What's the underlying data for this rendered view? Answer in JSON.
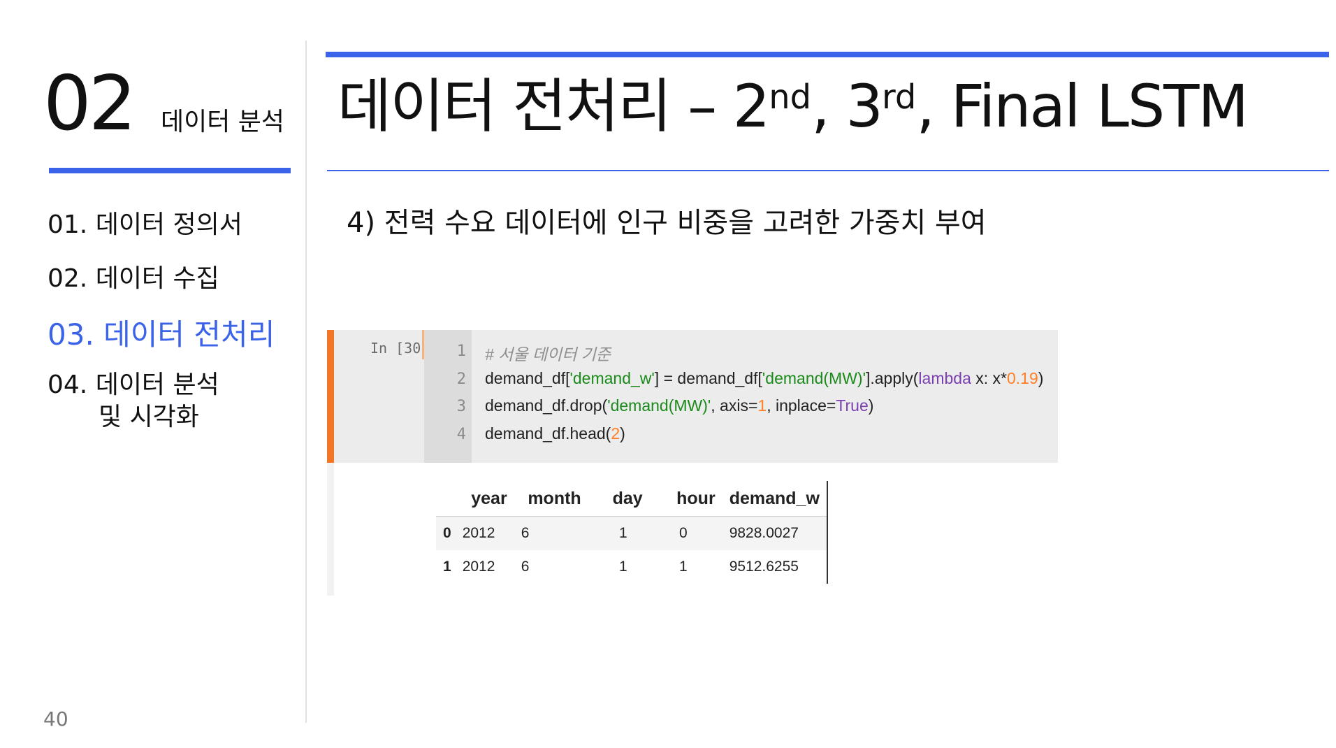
{
  "sidebar": {
    "section_number": "02",
    "section_title": "데이터 분석",
    "toc": [
      {
        "label": "01. 데이터 정의서"
      },
      {
        "label": "02. 데이터 수집"
      },
      {
        "label": "03. 데이터 전처리"
      },
      {
        "label_line1": "04. 데이터 분석",
        "label_line2": "및 시각화"
      }
    ],
    "page_number": "40"
  },
  "header": {
    "title_main": "데이터 전처리 – 2",
    "title_sup1": "nd",
    "title_mid": ", 3",
    "title_sup2": "rd",
    "title_end": ", Final LSTM",
    "subtitle": "4) 전력 수요 데이터에 인구 비중을 고려한 가중치 부여"
  },
  "cell": {
    "prompt": "In [30]:",
    "line_numbers": [
      "1",
      "2",
      "3",
      "4"
    ],
    "line1_comment": "# 서울 데이터 기준",
    "line2": {
      "a": "demand_df[",
      "b": "'demand_w'",
      "c": "] = demand_df[",
      "d": "'demand(MW)'",
      "e": "].apply(",
      "f": "lambda",
      "g": " x: x*",
      "h": "0.19",
      "i": ")"
    },
    "line3": {
      "a": "demand_df.drop(",
      "b": "'demand(MW)'",
      "c": ", axis=",
      "d": "1",
      "e": ", inplace=",
      "f": "True",
      "g": ")"
    },
    "line4": {
      "a": "demand_df.head(",
      "b": "2",
      "c": ")"
    }
  },
  "output_table": {
    "columns": [
      "year",
      "month",
      "day",
      "hour",
      "demand_w"
    ],
    "rows": [
      {
        "index": "0",
        "values": [
          "2012",
          "6",
          "1",
          "0",
          "9828.0027"
        ]
      },
      {
        "index": "1",
        "values": [
          "2012",
          "6",
          "1",
          "1",
          "9512.6255"
        ]
      }
    ]
  },
  "colors": {
    "accent": "#3b63ea",
    "cell_marker": "#f37626"
  }
}
